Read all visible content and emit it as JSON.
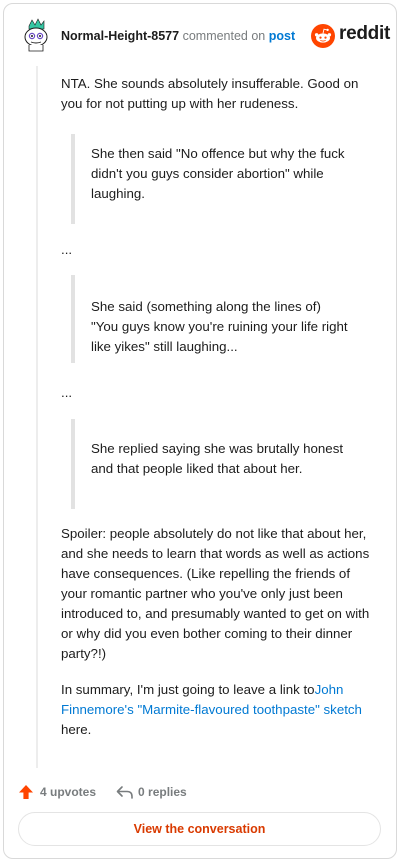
{
  "header": {
    "username": "Normal-Height-8577",
    "action": "commented on",
    "target": "post",
    "brand": "reddit"
  },
  "comment": {
    "p1": "NTA. She sounds absolutely insufferable. Good on you for not putting up with her rudeness.",
    "quote1": "She then said \"No offence but why the fuck didn't you guys consider abortion\" while laughing.",
    "ellipsis1": "...",
    "quote2": "She said (something along the lines of) \"You guys know you're ruining your life right like yikes\" still laughing...",
    "ellipsis2": "...",
    "quote3": "She replied saying she was brutally honest and that people liked that about her.",
    "p4": "Spoiler: people absolutely do not like that about her, and she needs to learn that words as well as actions have consequences. (Like repelling the friends of your romantic partner who you've only just been introduced to, and presumably wanted to get on with or why did you even bother coming to their dinner party?!)",
    "p5_before": "In summary, I'm just going to leave a link to",
    "p5_link": "John Finnemore's \"Marmite-flavoured toothpaste\" sketch",
    "p5_after": " here."
  },
  "footer": {
    "upvotes": "4 upvotes",
    "replies": "0 replies",
    "view_button": "View the conversation"
  },
  "colors": {
    "brand_orange": "#ff4500",
    "link_blue": "#0079d3",
    "button_text": "#d93a00",
    "muted": "#787c7e"
  },
  "icons": [
    "avatar-snoo-icon",
    "reddit-logo-icon",
    "upvote-arrow-icon",
    "reply-arrow-icon"
  ]
}
